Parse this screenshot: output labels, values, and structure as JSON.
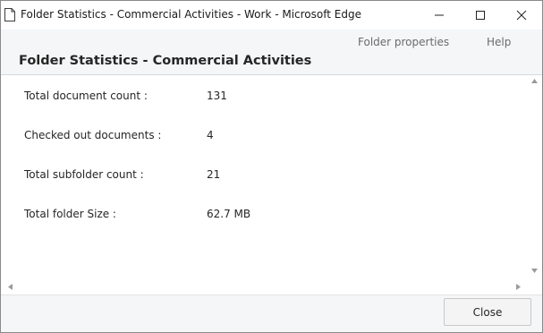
{
  "window": {
    "title": "Folder Statistics - Commercial Activities - Work - Microsoft Edge"
  },
  "header": {
    "links": {
      "folder_properties": "Folder properties",
      "help": "Help"
    },
    "title": "Folder Statistics - Commercial Activities"
  },
  "stats": [
    {
      "label": "Total document count :",
      "value": "131"
    },
    {
      "label": "Checked out documents :",
      "value": "4"
    },
    {
      "label": "Total subfolder count :",
      "value": "21"
    },
    {
      "label": "Total folder Size :",
      "value": "62.7 MB"
    }
  ],
  "footer": {
    "close_label": "Close"
  },
  "icons": {
    "page": "page-icon",
    "minimize": "minimize-icon",
    "maximize": "maximize-icon",
    "close": "close-icon",
    "scroll_up": "scroll-up-arrow-icon",
    "scroll_down": "scroll-down-arrow-icon",
    "scroll_left": "scroll-left-arrow-icon",
    "scroll_right": "scroll-right-arrow-icon"
  }
}
